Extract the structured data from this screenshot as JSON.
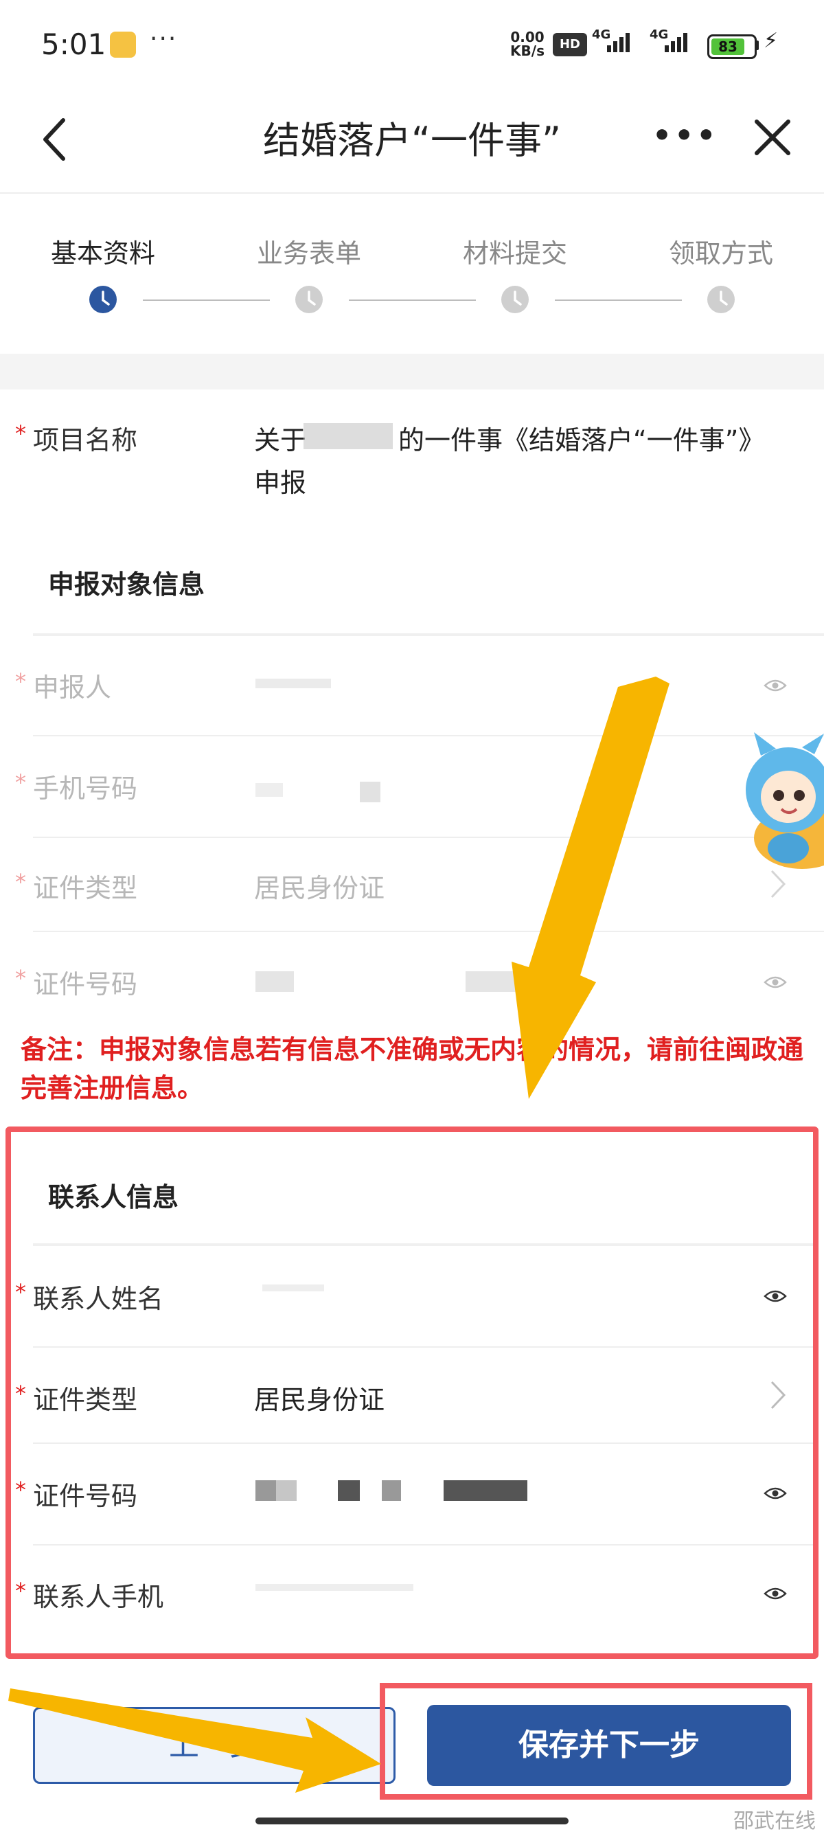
{
  "status_bar": {
    "time": "5:01",
    "net_speed_value": "0.00",
    "net_speed_unit": "KB/s",
    "hd_badge": "HD",
    "signal1": "4G",
    "signal2": "4G",
    "battery": "83"
  },
  "nav": {
    "title": "结婚落户“一件事”",
    "more": "•••"
  },
  "steps": [
    {
      "label": "基本资料",
      "active": true
    },
    {
      "label": "业务表单",
      "active": false
    },
    {
      "label": "材料提交",
      "active": false
    },
    {
      "label": "领取方式",
      "active": false
    }
  ],
  "project": {
    "label": "项目名称",
    "value_line1": "关于",
    "value_line1b": "的一件事《结婚落户“一件事”》",
    "value_line2": "申报"
  },
  "applicant_section": {
    "title": "申报对象信息",
    "rows": [
      {
        "label": "申报人"
      },
      {
        "label": "手机号码"
      },
      {
        "label": "证件类型",
        "value": "居民身份证"
      },
      {
        "label": "证件号码"
      }
    ]
  },
  "note": "备注：申报对象信息若有信息不准确或无内容的情况，请前往闽政通完善注册信息。",
  "contact_section": {
    "title": "联系人信息",
    "rows": [
      {
        "label": "联系人姓名"
      },
      {
        "label": "证件类型",
        "value": "居民身份证"
      },
      {
        "label": "证件号码"
      },
      {
        "label": "联系人手机"
      }
    ]
  },
  "buttons": {
    "prev": "上一步",
    "next": "保存并下一步"
  },
  "watermark": "邵武在线",
  "colors": {
    "primary": "#2c57a0",
    "required": "#e02020",
    "highlight": "#f25a60",
    "arrow": "#f7b500"
  },
  "icons": [
    "back-arrow-icon",
    "more-icon",
    "close-icon",
    "clock-icon",
    "eye-icon",
    "chevron-right-icon"
  ]
}
